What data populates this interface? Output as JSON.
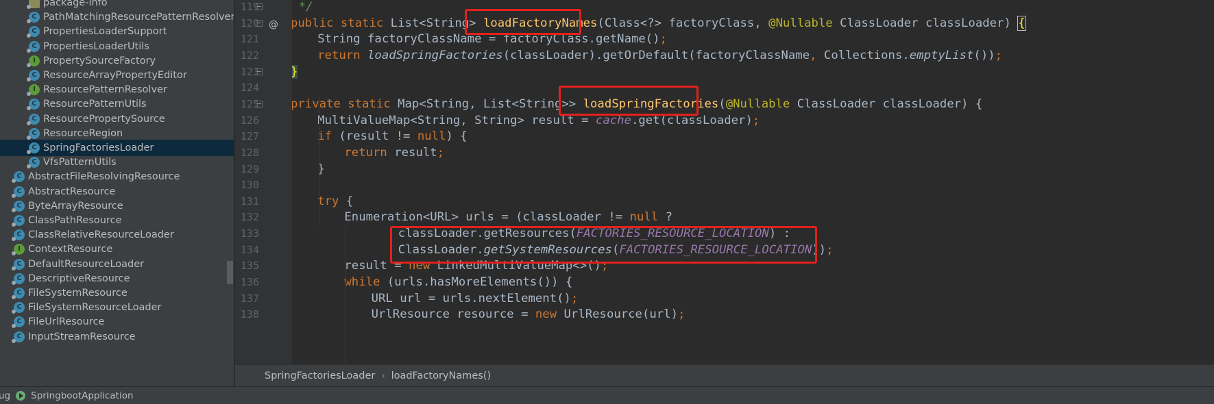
{
  "project_tree": {
    "items": [
      {
        "label": "package-info",
        "icon": "package-info-icon",
        "depth": 2
      },
      {
        "label": "PathMatchingResourcePatternResolver",
        "icon": "class-icon",
        "depth": 2
      },
      {
        "label": "PropertiesLoaderSupport",
        "icon": "class-icon",
        "depth": 2
      },
      {
        "label": "PropertiesLoaderUtils",
        "icon": "class-icon",
        "depth": 2
      },
      {
        "label": "PropertySourceFactory",
        "icon": "interface-icon",
        "depth": 2
      },
      {
        "label": "ResourceArrayPropertyEditor",
        "icon": "class-icon",
        "depth": 2
      },
      {
        "label": "ResourcePatternResolver",
        "icon": "interface-icon",
        "depth": 2
      },
      {
        "label": "ResourcePatternUtils",
        "icon": "class-icon",
        "depth": 2
      },
      {
        "label": "ResourcePropertySource",
        "icon": "class-icon",
        "depth": 2
      },
      {
        "label": "ResourceRegion",
        "icon": "class-icon",
        "depth": 2
      },
      {
        "label": "SpringFactoriesLoader",
        "icon": "class-icon",
        "depth": 2,
        "selected": true
      },
      {
        "label": "VfsPatternUtils",
        "icon": "class-icon",
        "depth": 2
      },
      {
        "label": "AbstractFileResolvingResource",
        "icon": "class-icon",
        "depth": 1
      },
      {
        "label": "AbstractResource",
        "icon": "class-icon",
        "depth": 1
      },
      {
        "label": "ByteArrayResource",
        "icon": "class-icon",
        "depth": 1
      },
      {
        "label": "ClassPathResource",
        "icon": "class-icon",
        "depth": 1
      },
      {
        "label": "ClassRelativeResourceLoader",
        "icon": "class-icon",
        "depth": 1
      },
      {
        "label": "ContextResource",
        "icon": "interface-icon",
        "depth": 1
      },
      {
        "label": "DefaultResourceLoader",
        "icon": "class-icon",
        "depth": 1
      },
      {
        "label": "DescriptiveResource",
        "icon": "class-icon",
        "depth": 1
      },
      {
        "label": "FileSystemResource",
        "icon": "class-icon",
        "depth": 1
      },
      {
        "label": "FileSystemResourceLoader",
        "icon": "class-icon",
        "depth": 1
      },
      {
        "label": "FileUrlResource",
        "icon": "class-icon",
        "depth": 1
      },
      {
        "label": "InputStreamResource",
        "icon": "class-icon",
        "depth": 1
      }
    ]
  },
  "editor": {
    "line_numbers": [
      "119",
      "120",
      "121",
      "122",
      "123",
      "124",
      "125",
      "126",
      "127",
      "128",
      "129",
      "130",
      "131",
      "132",
      "133",
      "134",
      "135",
      "136",
      "137",
      "138"
    ],
    "gutter_marker": "@",
    "code": {
      "l119": "*/",
      "l120": [
        "public",
        " ",
        "static",
        " List<String> ",
        "loadFactoryNames",
        "(Class<?> factoryClass, ",
        "@Nullable",
        " ClassLoader classLoader) ",
        "{"
      ],
      "l121": [
        "String factoryClassName = factoryClass.getName()",
        ";"
      ],
      "l122": [
        "return",
        " ",
        "loadSpringFactories",
        "(classLoader).getOrDefault(factoryClassName",
        ",",
        " Collections.",
        "emptyList",
        "())",
        ";"
      ],
      "l123": "}",
      "l125": [
        "private",
        " ",
        "static",
        " Map<String, List<String>> ",
        "loadSpringFactories",
        "(",
        "@Nullable",
        " ClassLoader classLoader) {"
      ],
      "l126": [
        "MultiValueMap<String, String> result = ",
        "cache",
        ".get(classLoader)",
        ";"
      ],
      "l127": [
        "if",
        " (result != ",
        "null",
        ") {"
      ],
      "l128": [
        "return",
        " result",
        ";"
      ],
      "l129": "}",
      "l131": [
        "try",
        " {"
      ],
      "l132": [
        "Enumeration<URL> urls = (classLoader != ",
        "null",
        " ?"
      ],
      "l133": [
        "classLoader.getResources(",
        "FACTORIES_RESOURCE_LOCATION",
        ") :"
      ],
      "l134": [
        "ClassLoader.",
        "getSystemResources",
        "(",
        "FACTORIES_RESOURCE_LOCATION",
        "))",
        ";"
      ],
      "l135": [
        "result = ",
        "new",
        " LinkedMultiValueMap<>()",
        ";"
      ],
      "l136": [
        "while",
        " (urls.hasMoreElements()) {"
      ],
      "l137": [
        "URL url = urls.nextElement()",
        ";"
      ],
      "l138": [
        "UrlResource resource = ",
        "new",
        " UrlResource(url)",
        ";"
      ]
    }
  },
  "breadcrumb": {
    "items": [
      "SpringFactoriesLoader",
      "loadFactoryNames()"
    ],
    "separator": "›"
  },
  "statusbar": {
    "run_prefix": "ug",
    "run_config": "SpringbootApplication"
  },
  "colors": {
    "background": "#2b2b2b",
    "keyword": "#cc7832",
    "annotation": "#bbb529",
    "method_decl": "#ffc66d",
    "static_field": "#9876aa",
    "text": "#a9b7c6",
    "highlight_box": "#e3211c",
    "selection": "#0d293e"
  }
}
